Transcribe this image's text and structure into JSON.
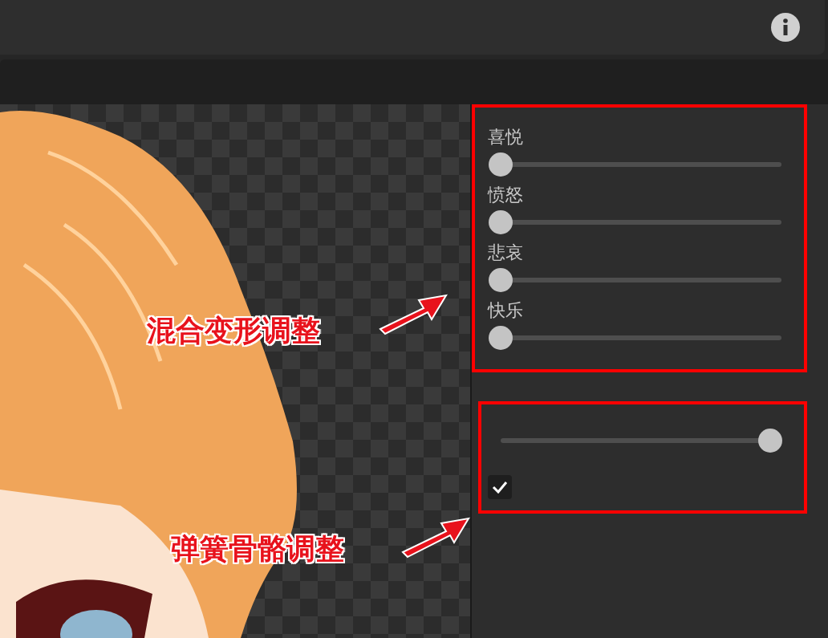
{
  "blend_shapes": [
    {
      "label": "喜悦",
      "level": 0
    },
    {
      "label": "愤怒",
      "level": 0
    },
    {
      "label": "悲哀",
      "level": 0
    },
    {
      "label": "快乐",
      "level": 0
    }
  ],
  "spring_bone": {
    "level": 0.96,
    "checked": true
  },
  "annotations": [
    {
      "text": "混合变形调整"
    },
    {
      "text": "弹簧骨骼调整"
    }
  ]
}
